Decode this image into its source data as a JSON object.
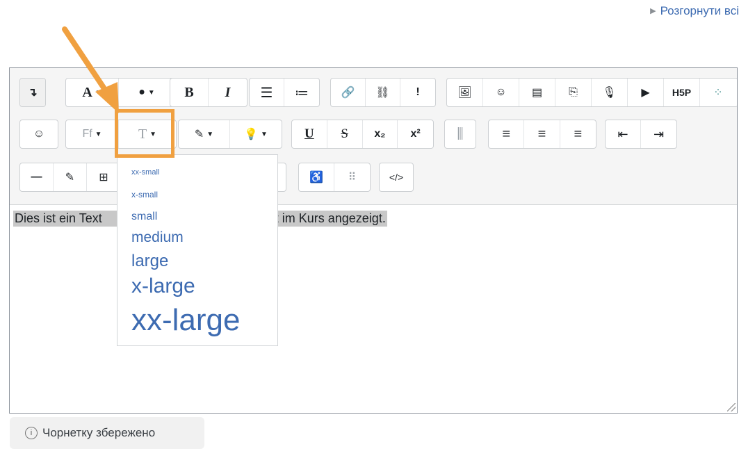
{
  "header": {
    "expand_link": "Розгорнути всі"
  },
  "toolbar": {
    "row1": {
      "group_collapse": [
        "↴"
      ],
      "group_style": [
        "A",
        "⬩"
      ],
      "group_format": [
        "B",
        "I"
      ],
      "group_lists": [
        "☰",
        "≔"
      ],
      "group_links": [
        "🔗",
        "⛓",
        "!"
      ],
      "group_media": [
        "🖼",
        "☺",
        "▤",
        "⎘",
        "🎙",
        "▶",
        "H5P",
        "⁘"
      ]
    },
    "row2": {
      "emoji": "☺",
      "font_family": "Ff",
      "font_size": "T",
      "group_colors": [
        "✎",
        "💡"
      ],
      "group_style2": [
        "U",
        "S",
        "x₂",
        "x²"
      ],
      "table_cols": "⫼",
      "group_align": [
        "≡",
        "≡",
        "≡"
      ],
      "group_indent": [
        "⇤",
        "⇥"
      ]
    },
    "row3": {
      "group_misc": [
        "—",
        "✎",
        "⊞"
      ],
      "group_access": [
        "♿",
        "⠿"
      ],
      "html": "</>"
    }
  },
  "content": {
    "text_left": "Dies ist ein Text",
    "text_right": "d wird direkt im Kurs angezeigt."
  },
  "font_size_menu": {
    "items": [
      "xx-small",
      "x-small",
      "small",
      "medium",
      "large",
      "x-large",
      "xx-large"
    ]
  },
  "status": {
    "draft_saved": "Чорнетку збережено",
    "info_icon": "i"
  },
  "colors": {
    "accent": "#f0a040",
    "link": "#3d6bb1"
  }
}
